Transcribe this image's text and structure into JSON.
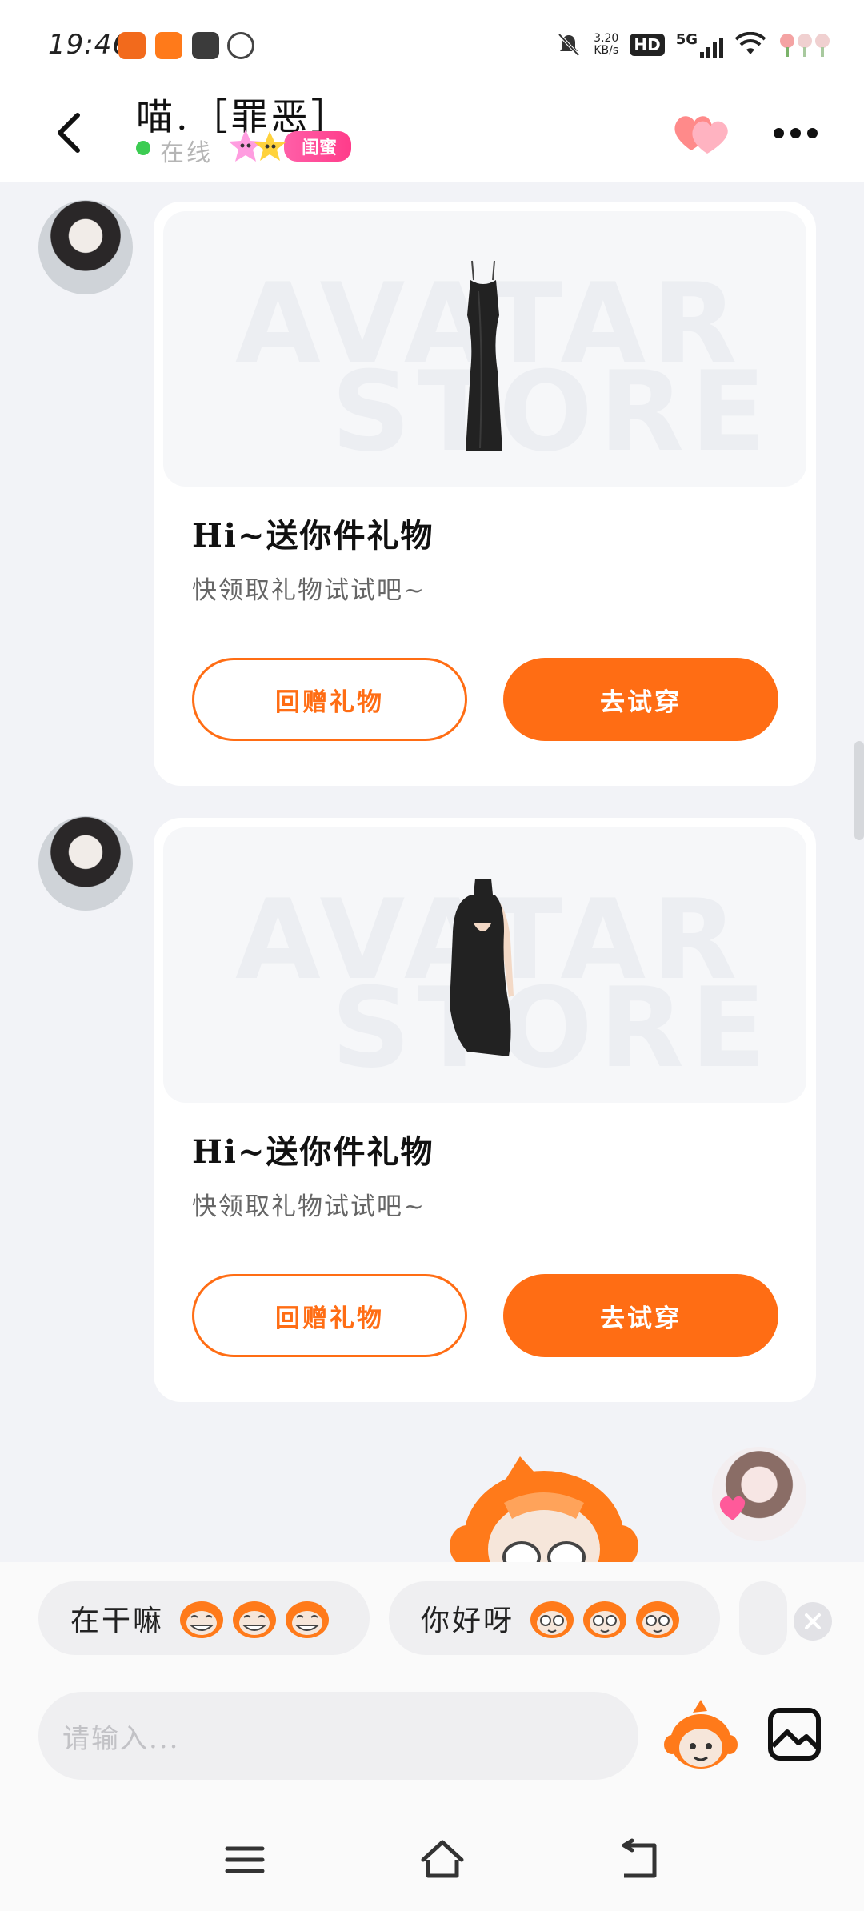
{
  "status_bar": {
    "time": "19:46",
    "network_speed_value": "3.20",
    "network_speed_unit": "KB/s",
    "hd": "HD",
    "signal": "5G"
  },
  "header": {
    "contact_name": "喵.［罪恶］",
    "status": "在线",
    "relation_badge": "闺蜜"
  },
  "messages": [
    {
      "type": "gift",
      "item": "dress",
      "watermark_line1": "AVATAR",
      "watermark_line2": "STORE",
      "title": "Hi~送你件礼物",
      "subtitle": "快领取礼物试试吧~",
      "return_label": "回赠礼物",
      "try_label": "去试穿"
    },
    {
      "type": "gift",
      "item": "halter-dress",
      "watermark_line1": "AVATAR",
      "watermark_line2": "STORE",
      "title": "Hi~送你件礼物",
      "subtitle": "快领取礼物试试吧~",
      "return_label": "回赠礼物",
      "try_label": "去试穿"
    }
  ],
  "quick_replies": [
    {
      "text": "在干嘛",
      "emoji": "grinning-monkey"
    },
    {
      "text": "你好呀",
      "emoji": "waving-monkey"
    }
  ],
  "composer": {
    "placeholder": "请输入..."
  },
  "colors": {
    "accent": "#ff6d14",
    "online": "#3ccc52",
    "badge": "#ff3c8a",
    "background": "#f2f3f7"
  },
  "icons": {
    "back": "chevron-left-icon",
    "favorite": "double-heart-icon",
    "more": "more-dots-icon",
    "emoji": "monkey-emoji-icon",
    "image": "image-icon",
    "close": "close-icon"
  }
}
